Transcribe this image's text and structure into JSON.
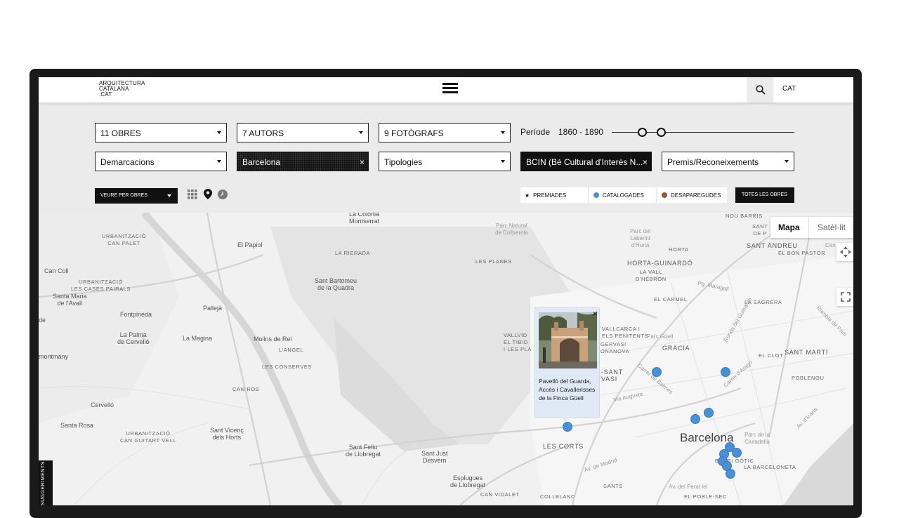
{
  "header": {
    "logo_lines": [
      "ARQUITECTURA",
      "CATALANA",
      ".CAT"
    ],
    "language": "CAT"
  },
  "filters": {
    "obres": "11 OBRES",
    "autors": "7 AUTORS",
    "fotografs": "9 FOTÒGRAFS",
    "periode_label": "Període",
    "periode_range": "1860 - 1890",
    "demarcacions": "Demarcacions",
    "barcelona": "Barcelona",
    "tipologies": "Tipologies",
    "bcin": "BCIN (Bé Cultural d'Interès N...",
    "premis": "Premis/Reconeixements"
  },
  "view": {
    "select_label": "VEURE PER OBRES",
    "icons": [
      "grid-icon",
      "pin-icon",
      "clock-icon"
    ]
  },
  "legend": {
    "premiades": "PREMIADES",
    "catalogades": "CATALOGADES",
    "catalogades_color": "#4a90d6",
    "desaparegudes": "DESAPAREGUDES",
    "desaparegudes_color": "#a0522d",
    "totes": "TOTES LES OBRES"
  },
  "map": {
    "type_map": "Mapa",
    "type_sat": "Satèl·lit",
    "labels": {
      "colonia": "La Colònia\nMontserrat",
      "parc_collserola": "Parc Natural\nde Collserola",
      "nou_barris": "NOU BARRIS",
      "sant_de_p": "SANT\nDE P",
      "urb_can_palet": "URBANITZACIÓ\nCAN PALET",
      "el_papiol": "El Papiol",
      "la_rierada": "LA RIERADA",
      "parc_laberint": "Parc del\nLaberint\nd'Horta",
      "horta": "HORTA",
      "sant_andreu": "SANT ANDREU",
      "el_bon_pastor": "EL BON PASTOR",
      "can_ze": "Can Ze",
      "can_coll": "Can Coll",
      "urb_cases_pairals": "URBANITZACIÓ\nLES CASES PAIRALS",
      "les_planes": "LES PLANES",
      "sant_bartomeu": "Sant Bartomeu\nde la Quadra",
      "horta_guinardo": "HORTA-GUINARDÓ",
      "la_vall": "LA VALL\nD'HEBRON",
      "santa_maria": "Santa Maria\nde l'Avall",
      "pg_maragall": "Pg. Maragall",
      "pallejà": "Pallejà",
      "fontpineda": "Fontpineda",
      "el_carmel": "EL CARMEL",
      "la_sagrera": "LA SAGRERA",
      "de": "de",
      "la_palma": "La Palma\nde Cervelló",
      "la_magina": "La Magina",
      "molins": "Molins de Rei",
      "l_angel": "L'ÀNGEL",
      "vallvidrera": "VALLVID\nEL TIBID\nI LES PLA",
      "vallcarca": "VALLCARCA I\nELS PENITENTS",
      "parc_guell": "Parc Güell",
      "gervasi": "GERVASI\nONANOVA",
      "gracia": "GRÀCIA",
      "montmany": "montmany",
      "les_conserves": "LES CONSERVES",
      "el_clot": "EL CLOT",
      "sant_marti": "SANT MARTÍ",
      "sant_gervasi": "-SANT\nVASI",
      "poblenou": "POBLENOU",
      "can_ros": "CAN ROS",
      "via_augusta": "Via Augusta",
      "cervello": "Cervelló",
      "santa_rosa": "Santa Rosa",
      "urb_can_guitart": "URBANITZACIÓ\nCAN GUITART VELL",
      "sant_vicenc": "Sant Vicenç\ndels Horts",
      "les_corts": "LES CORTS",
      "barcelona": "Barcelona",
      "parc_ciutadella": "Parc de la\nCiutadella",
      "sant_feliu": "Sant Feliu\nde Llobregat",
      "sant_just": "Sant Just\nDesvern",
      "barri_gotic": "BARRI GÒTIC",
      "la_barceloneta": "LA BARCELONETA",
      "av_madrid": "Av. de Madrid",
      "esplugues": "Esplugues\nde Llobregat",
      "sants": "SANTS",
      "can_vidalet": "CAN VIDALET",
      "collblanc": "COLLBLANC",
      "av_parallel": "Av. del Paral·lel",
      "el_poble_sec": "EL POBLE-SEC",
      "ronda_guinardo": "Ronda del Guinardó",
      "carrer_arago": "Carrer d'Aragó",
      "carrer_balmes": "Carrer de Balmes",
      "rambla_prim": "Rambla de Prim",
      "av_icaria": "Av. d'Icària"
    },
    "popup": {
      "close": "×",
      "title": "Pavelló del Guarda, Accés i Cavallerisses de la Finca Güell"
    }
  },
  "sidebar_tab": "SUGGERIMENTS"
}
